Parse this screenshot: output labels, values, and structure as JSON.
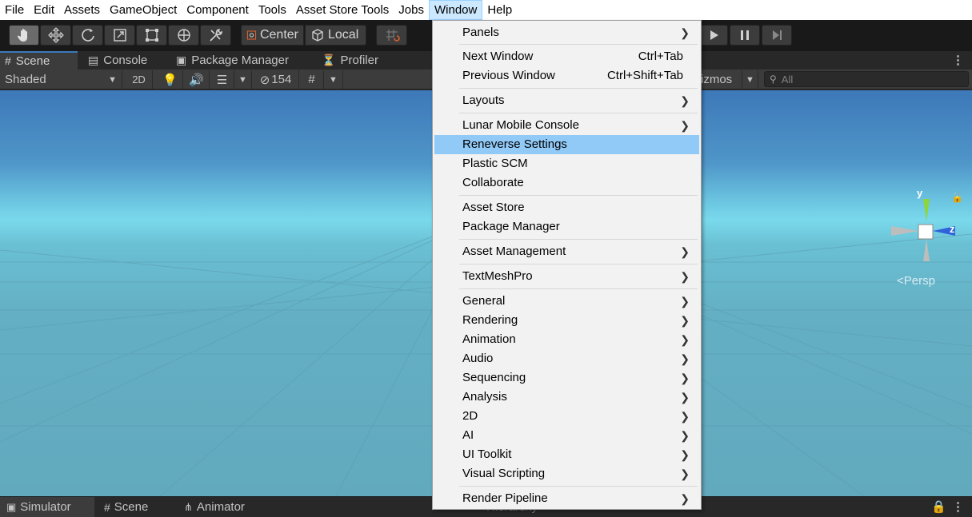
{
  "menubar": {
    "items": [
      "File",
      "Edit",
      "Assets",
      "GameObject",
      "Component",
      "Tools",
      "Asset Store Tools",
      "Jobs",
      "Window",
      "Help"
    ]
  },
  "toolbar": {
    "pivot_center": "Center",
    "pivot_local": "Local"
  },
  "tabs": {
    "scene": "Scene",
    "console": "Console",
    "package_manager": "Package Manager",
    "profiler": "Profiler"
  },
  "scenebar": {
    "shading": "Shaded",
    "mode_2d": "2D",
    "hidden_count": "154",
    "gizmos": "izmos",
    "search_placeholder": "All"
  },
  "gizmo": {
    "y_label": "y",
    "z_label": "z",
    "projection": "Persp"
  },
  "bottom_tabs": {
    "simulator": "Simulator",
    "scene": "Scene",
    "animator": "Animator",
    "hierarchy": "Hierarchy"
  },
  "window_menu": {
    "panels": "Panels",
    "next_window": "Next Window",
    "next_window_shortcut": "Ctrl+Tab",
    "previous_window": "Previous Window",
    "previous_window_shortcut": "Ctrl+Shift+Tab",
    "layouts": "Layouts",
    "lunar_mobile_console": "Lunar Mobile Console",
    "reneverse_settings": "Reneverse Settings",
    "plastic_scm": "Plastic SCM",
    "collaborate": "Collaborate",
    "asset_store": "Asset Store",
    "package_manager": "Package Manager",
    "asset_management": "Asset Management",
    "textmeshpro": "TextMeshPro",
    "general": "General",
    "rendering": "Rendering",
    "animation": "Animation",
    "audio": "Audio",
    "sequencing": "Sequencing",
    "analysis": "Analysis",
    "two_d": "2D",
    "ai": "AI",
    "ui_toolkit": "UI Toolkit",
    "visual_scripting": "Visual Scripting",
    "render_pipeline": "Render Pipeline",
    "highlighted_item": "Reneverse Settings"
  },
  "colors": {
    "menu_highlight": "#91c9f7",
    "active_menubar_item": "#cce8ff",
    "sky_top": "#3d78b8",
    "horizon": "#7ad9ec",
    "ground": "#62a9bd"
  }
}
